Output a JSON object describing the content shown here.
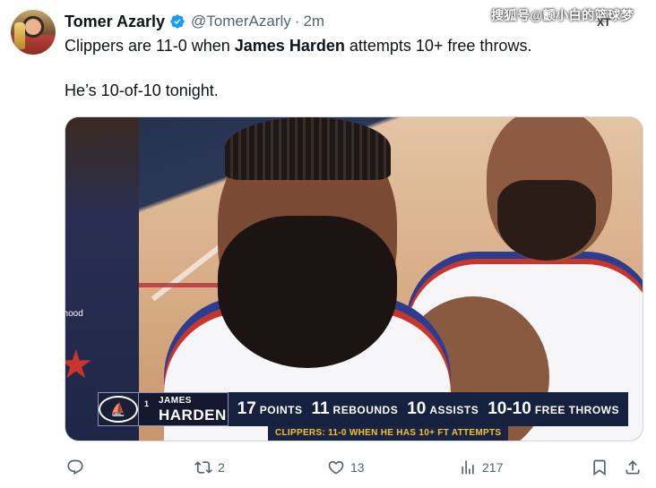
{
  "tweet": {
    "author_name": "Tomer Azarly",
    "handle": "@TomerAzarly",
    "separator": "·",
    "time": "2m",
    "text_part1": "Clippers are 11-0 when ",
    "text_bold": "James Harden",
    "text_part2": " attempts 10+ free throws.",
    "text_line2": "He’s 10-of-10 tonight."
  },
  "watermark": "搜狐号@颤小白的篮球梦",
  "watermark_small": "XT",
  "media": {
    "left_player_text": "nhood",
    "banner": {
      "number": "1",
      "first_name": "JAMES",
      "last_name": "HARDEN",
      "stats": [
        {
          "num": "17",
          "label": "POINTS"
        },
        {
          "num": "11",
          "label": "REBOUNDS"
        },
        {
          "num": "10",
          "label": "ASSISTS"
        },
        {
          "num": "10-10",
          "label": "FREE THROWS"
        }
      ],
      "sub": "CLIPPERS: 11-0 WHEN HE HAS 10+ FT ATTEMPTS"
    }
  },
  "actions": {
    "reply_count": "",
    "retweet_count": "2",
    "like_count": "13",
    "views_count": "217"
  },
  "colors": {
    "verified": "#1d9bf0",
    "text": "#0f1419",
    "muted": "#536471",
    "banner_gold": "#f1c232"
  }
}
